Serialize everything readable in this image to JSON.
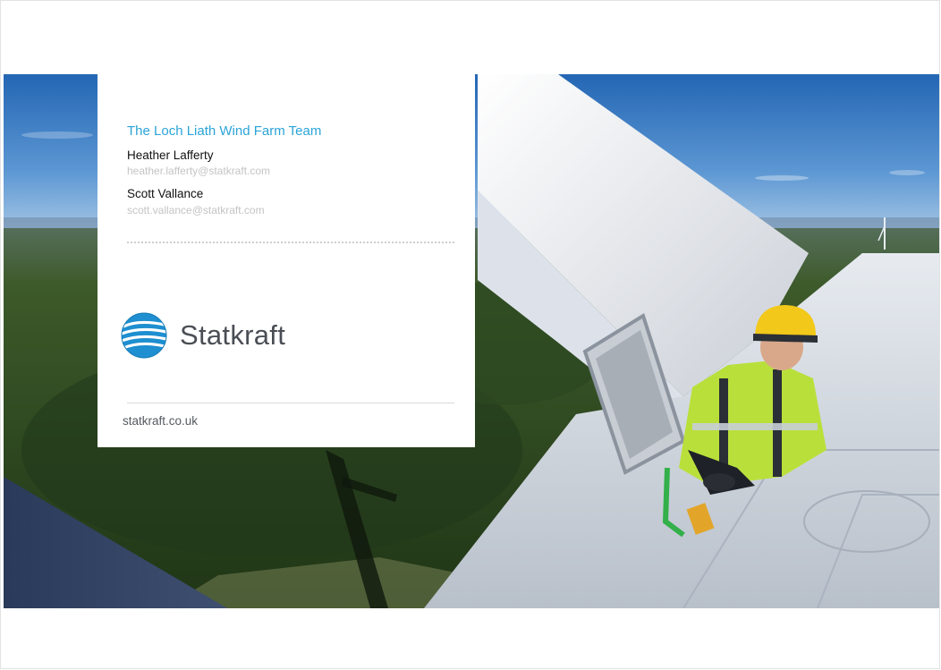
{
  "card": {
    "title": "The Loch Liath Wind Farm Team",
    "contacts": [
      {
        "name": "Heather Lafferty",
        "email": "heather.lafferty@statkraft.com"
      },
      {
        "name": "Scott Vallance",
        "email": "scott.vallance@statkraft.com"
      }
    ],
    "logo": {
      "wordmark": "Statkraft",
      "icon": "statkraft-logo-icon"
    },
    "website": "statkraft.co.uk"
  },
  "colors": {
    "title_accent": "#2aa4d6",
    "logo_blue": "#1e8fd0",
    "logo_text": "#4a4e54",
    "sky": "#2f79c4",
    "forest": "#2f4a22",
    "hivis": "#b9e03a"
  },
  "photo": {
    "subject": "photo of a wind turbine technician in a hi-vis jacket and yellow helmet on top of a turbine nacelle above a forest"
  }
}
